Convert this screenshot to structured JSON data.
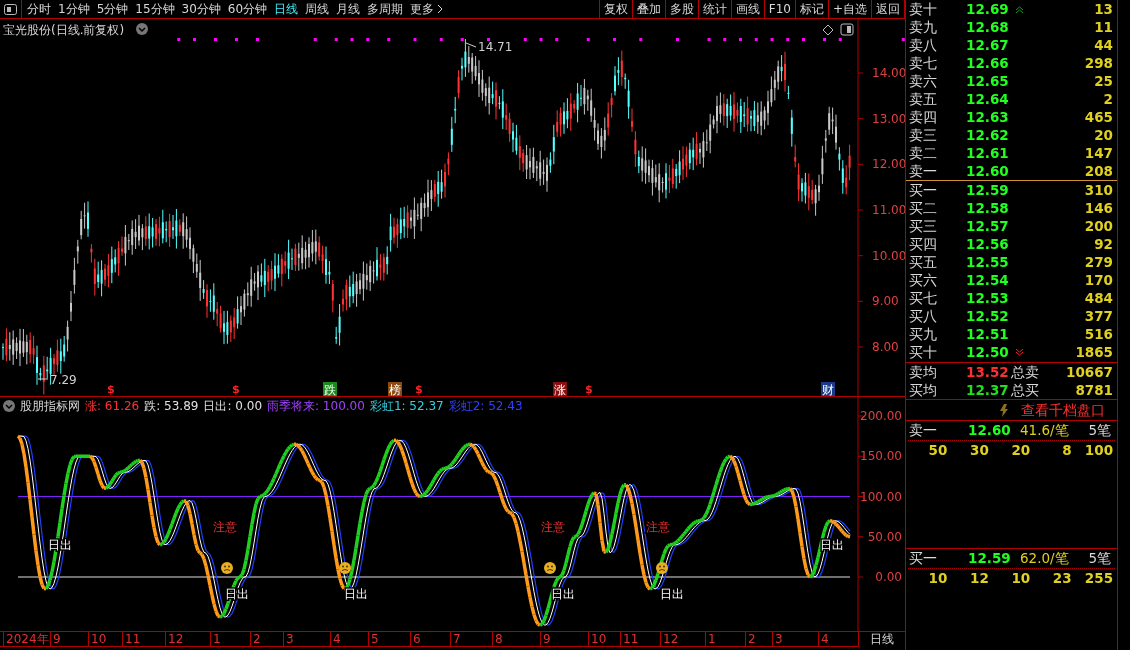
{
  "toolbar": {
    "periods": [
      {
        "label": "分时",
        "selected": false
      },
      {
        "label": "1分钟",
        "selected": false
      },
      {
        "label": "5分钟",
        "selected": false
      },
      {
        "label": "15分钟",
        "selected": false
      },
      {
        "label": "30分钟",
        "selected": false
      },
      {
        "label": "60分钟",
        "selected": false
      },
      {
        "label": "日线",
        "selected": true
      },
      {
        "label": "周线",
        "selected": false
      },
      {
        "label": "月线",
        "selected": false
      },
      {
        "label": "多周期",
        "selected": false
      },
      {
        "label": "更多",
        "selected": false
      }
    ],
    "actions": [
      "复权",
      "叠加",
      "多股",
      "统计",
      "画线",
      "F10",
      "标记",
      "+自选",
      "返回"
    ]
  },
  "chart": {
    "title": "宝光股份(日线.前复权)",
    "high_label": "14.71",
    "low_label": "7.29",
    "y_axis": [
      "14.00",
      "13.00",
      "12.00",
      "11.00",
      "10.00",
      "9.00",
      "8.00"
    ],
    "markers": [
      {
        "kind": "signal",
        "label": "$"
      },
      {
        "kind": "signal",
        "label": "$"
      },
      {
        "kind": "tag",
        "label": "跌",
        "color": "#1a8a1a"
      },
      {
        "kind": "tag",
        "label": "榜",
        "color": "#8a4a10"
      },
      {
        "kind": "signal",
        "label": "$"
      },
      {
        "kind": "tag",
        "label": "涨",
        "color": "#8a1010"
      },
      {
        "kind": "signal",
        "label": "$"
      },
      {
        "kind": "tag",
        "label": "财",
        "color": "#1a3a8a"
      }
    ]
  },
  "indicator": {
    "name": "股朋指标网",
    "legend": [
      {
        "label": "涨: 61.26",
        "color": "#ff3030"
      },
      {
        "label": "跌: 53.89",
        "color": "#e0e0e0"
      },
      {
        "label": "日出: 0.00",
        "color": "#e0e0e0"
      },
      {
        "label": "雨季将来: 100.00",
        "color": "#a040ff"
      },
      {
        "label": "彩虹1: 52.37",
        "color": "#30d0e0"
      },
      {
        "label": "彩虹2: 52.43",
        "color": "#3040ff"
      }
    ],
    "y_axis": [
      "200.00",
      "150.00",
      "100.00",
      "50.00",
      "0.00"
    ],
    "annotations": [
      {
        "kind": "sunrise",
        "label": "日出"
      },
      {
        "kind": "warning",
        "label": "注意"
      },
      {
        "kind": "sunrise",
        "label": "日出"
      },
      {
        "kind": "sunrise",
        "label": "日出"
      },
      {
        "kind": "warning",
        "label": "注意"
      },
      {
        "kind": "sunrise",
        "label": "日出"
      },
      {
        "kind": "warning",
        "label": "注意"
      },
      {
        "kind": "sunrise",
        "label": "日出"
      },
      {
        "kind": "sunrise",
        "label": "日出"
      }
    ]
  },
  "time_axis": {
    "labels": [
      "2024年",
      "9",
      "10",
      "11",
      "12",
      "1",
      "2",
      "3",
      "4",
      "5",
      "6",
      "7",
      "8",
      "9",
      "10",
      "11",
      "12",
      "1",
      "2",
      "3",
      "4"
    ],
    "period": "日线"
  },
  "order_book": {
    "asks": [
      {
        "name": "卖十",
        "price": "12.69",
        "volume": "13"
      },
      {
        "name": "卖九",
        "price": "12.68",
        "volume": "11"
      },
      {
        "name": "卖八",
        "price": "12.67",
        "volume": "44"
      },
      {
        "name": "卖七",
        "price": "12.66",
        "volume": "298"
      },
      {
        "name": "卖六",
        "price": "12.65",
        "volume": "25"
      },
      {
        "name": "卖五",
        "price": "12.64",
        "volume": "2"
      },
      {
        "name": "卖四",
        "price": "12.63",
        "volume": "465"
      },
      {
        "name": "卖三",
        "price": "12.62",
        "volume": "20"
      },
      {
        "name": "卖二",
        "price": "12.61",
        "volume": "147"
      },
      {
        "name": "卖一",
        "price": "12.60",
        "volume": "208"
      }
    ],
    "bids": [
      {
        "name": "买一",
        "price": "12.59",
        "volume": "310"
      },
      {
        "name": "买二",
        "price": "12.58",
        "volume": "146"
      },
      {
        "name": "买三",
        "price": "12.57",
        "volume": "200"
      },
      {
        "name": "买四",
        "price": "12.56",
        "volume": "92"
      },
      {
        "name": "买五",
        "price": "12.55",
        "volume": "279"
      },
      {
        "name": "买六",
        "price": "12.54",
        "volume": "170"
      },
      {
        "name": "买七",
        "price": "12.53",
        "volume": "484"
      },
      {
        "name": "买八",
        "price": "12.52",
        "volume": "377"
      },
      {
        "name": "买九",
        "price": "12.51",
        "volume": "516"
      },
      {
        "name": "买十",
        "price": "12.50",
        "volume": "1865"
      }
    ],
    "summary": [
      {
        "name": "卖均",
        "price": "13.52",
        "color": "#ff3030",
        "total_label": "总卖",
        "total": "10667"
      },
      {
        "name": "买均",
        "price": "12.37",
        "color": "#20e020",
        "total_label": "总买",
        "total": "8781"
      }
    ]
  },
  "depth": {
    "link": "查看千档盘口",
    "levels": [
      {
        "name": "卖一",
        "price": "12.60",
        "average": "41.6/笔",
        "count": "5笔",
        "orders": [
          "50",
          "30",
          "20",
          "8",
          "100"
        ]
      },
      {
        "name": "买一",
        "price": "12.59",
        "average": "62.0/笔",
        "count": "5笔",
        "orders": [
          "10",
          "12",
          "10",
          "23",
          "255"
        ]
      }
    ]
  }
}
